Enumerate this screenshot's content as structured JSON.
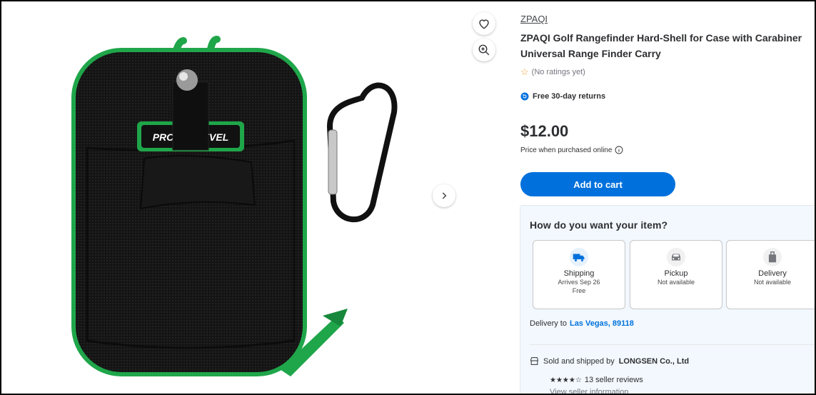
{
  "product": {
    "brand": "ZPAQI",
    "title": "ZPAQI Golf Rangefinder Hard-Shell for Case with Carabiner Universal Range Finder Carry",
    "rating_text": "(No ratings yet)",
    "returns_text": "Free 30-day returns",
    "price": "$12.00",
    "price_note": "Price when purchased online",
    "add_to_cart": "Add to cart",
    "image_badge_text": "PROFES  LEVEL"
  },
  "fulfillment": {
    "title": "How do you want your item?",
    "options": [
      {
        "label": "Shipping",
        "line1": "Arrives Sep 26",
        "line2": "Free",
        "icon": "truck-icon"
      },
      {
        "label": "Pickup",
        "line1": "Not available",
        "line2": "",
        "icon": "car-icon"
      },
      {
        "label": "Delivery",
        "line1": "Not available",
        "line2": "",
        "icon": "bag-icon"
      }
    ],
    "delivery_prefix": "Delivery to",
    "delivery_location": "Las Vegas, 89118"
  },
  "seller": {
    "prefix": "Sold and shipped by",
    "name": "LONGSEN Co., Ltd",
    "stars": "★★★★☆",
    "reviews": "13 seller reviews",
    "info_link": "View seller information"
  },
  "colors": {
    "accent": "#0071dc",
    "case_trim": "#1fa64a"
  }
}
